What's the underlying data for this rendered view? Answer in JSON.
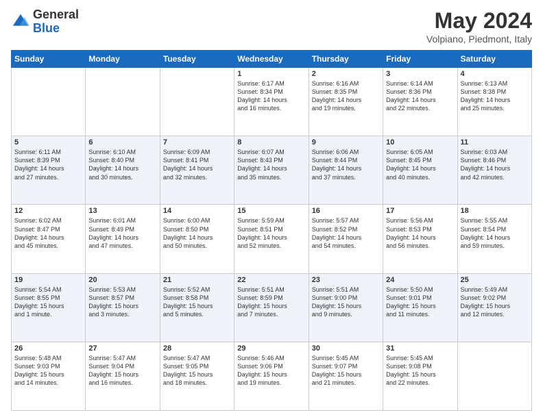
{
  "logo": {
    "general": "General",
    "blue": "Blue"
  },
  "header": {
    "title": "May 2024",
    "location": "Volpiano, Piedmont, Italy"
  },
  "weekdays": [
    "Sunday",
    "Monday",
    "Tuesday",
    "Wednesday",
    "Thursday",
    "Friday",
    "Saturday"
  ],
  "weeks": [
    [
      {
        "day": "",
        "info": ""
      },
      {
        "day": "",
        "info": ""
      },
      {
        "day": "",
        "info": ""
      },
      {
        "day": "1",
        "info": "Sunrise: 6:17 AM\nSunset: 8:34 PM\nDaylight: 14 hours\nand 16 minutes."
      },
      {
        "day": "2",
        "info": "Sunrise: 6:16 AM\nSunset: 8:35 PM\nDaylight: 14 hours\nand 19 minutes."
      },
      {
        "day": "3",
        "info": "Sunrise: 6:14 AM\nSunset: 8:36 PM\nDaylight: 14 hours\nand 22 minutes."
      },
      {
        "day": "4",
        "info": "Sunrise: 6:13 AM\nSunset: 8:38 PM\nDaylight: 14 hours\nand 25 minutes."
      }
    ],
    [
      {
        "day": "5",
        "info": "Sunrise: 6:11 AM\nSunset: 8:39 PM\nDaylight: 14 hours\nand 27 minutes."
      },
      {
        "day": "6",
        "info": "Sunrise: 6:10 AM\nSunset: 8:40 PM\nDaylight: 14 hours\nand 30 minutes."
      },
      {
        "day": "7",
        "info": "Sunrise: 6:09 AM\nSunset: 8:41 PM\nDaylight: 14 hours\nand 32 minutes."
      },
      {
        "day": "8",
        "info": "Sunrise: 6:07 AM\nSunset: 8:43 PM\nDaylight: 14 hours\nand 35 minutes."
      },
      {
        "day": "9",
        "info": "Sunrise: 6:06 AM\nSunset: 8:44 PM\nDaylight: 14 hours\nand 37 minutes."
      },
      {
        "day": "10",
        "info": "Sunrise: 6:05 AM\nSunset: 8:45 PM\nDaylight: 14 hours\nand 40 minutes."
      },
      {
        "day": "11",
        "info": "Sunrise: 6:03 AM\nSunset: 8:46 PM\nDaylight: 14 hours\nand 42 minutes."
      }
    ],
    [
      {
        "day": "12",
        "info": "Sunrise: 6:02 AM\nSunset: 8:47 PM\nDaylight: 14 hours\nand 45 minutes."
      },
      {
        "day": "13",
        "info": "Sunrise: 6:01 AM\nSunset: 8:49 PM\nDaylight: 14 hours\nand 47 minutes."
      },
      {
        "day": "14",
        "info": "Sunrise: 6:00 AM\nSunset: 8:50 PM\nDaylight: 14 hours\nand 50 minutes."
      },
      {
        "day": "15",
        "info": "Sunrise: 5:59 AM\nSunset: 8:51 PM\nDaylight: 14 hours\nand 52 minutes."
      },
      {
        "day": "16",
        "info": "Sunrise: 5:57 AM\nSunset: 8:52 PM\nDaylight: 14 hours\nand 54 minutes."
      },
      {
        "day": "17",
        "info": "Sunrise: 5:56 AM\nSunset: 8:53 PM\nDaylight: 14 hours\nand 56 minutes."
      },
      {
        "day": "18",
        "info": "Sunrise: 5:55 AM\nSunset: 8:54 PM\nDaylight: 14 hours\nand 59 minutes."
      }
    ],
    [
      {
        "day": "19",
        "info": "Sunrise: 5:54 AM\nSunset: 8:55 PM\nDaylight: 15 hours\nand 1 minute."
      },
      {
        "day": "20",
        "info": "Sunrise: 5:53 AM\nSunset: 8:57 PM\nDaylight: 15 hours\nand 3 minutes."
      },
      {
        "day": "21",
        "info": "Sunrise: 5:52 AM\nSunset: 8:58 PM\nDaylight: 15 hours\nand 5 minutes."
      },
      {
        "day": "22",
        "info": "Sunrise: 5:51 AM\nSunset: 8:59 PM\nDaylight: 15 hours\nand 7 minutes."
      },
      {
        "day": "23",
        "info": "Sunrise: 5:51 AM\nSunset: 9:00 PM\nDaylight: 15 hours\nand 9 minutes."
      },
      {
        "day": "24",
        "info": "Sunrise: 5:50 AM\nSunset: 9:01 PM\nDaylight: 15 hours\nand 11 minutes."
      },
      {
        "day": "25",
        "info": "Sunrise: 5:49 AM\nSunset: 9:02 PM\nDaylight: 15 hours\nand 12 minutes."
      }
    ],
    [
      {
        "day": "26",
        "info": "Sunrise: 5:48 AM\nSunset: 9:03 PM\nDaylight: 15 hours\nand 14 minutes."
      },
      {
        "day": "27",
        "info": "Sunrise: 5:47 AM\nSunset: 9:04 PM\nDaylight: 15 hours\nand 16 minutes."
      },
      {
        "day": "28",
        "info": "Sunrise: 5:47 AM\nSunset: 9:05 PM\nDaylight: 15 hours\nand 18 minutes."
      },
      {
        "day": "29",
        "info": "Sunrise: 5:46 AM\nSunset: 9:06 PM\nDaylight: 15 hours\nand 19 minutes."
      },
      {
        "day": "30",
        "info": "Sunrise: 5:45 AM\nSunset: 9:07 PM\nDaylight: 15 hours\nand 21 minutes."
      },
      {
        "day": "31",
        "info": "Sunrise: 5:45 AM\nSunset: 9:08 PM\nDaylight: 15 hours\nand 22 minutes."
      },
      {
        "day": "",
        "info": ""
      }
    ]
  ]
}
